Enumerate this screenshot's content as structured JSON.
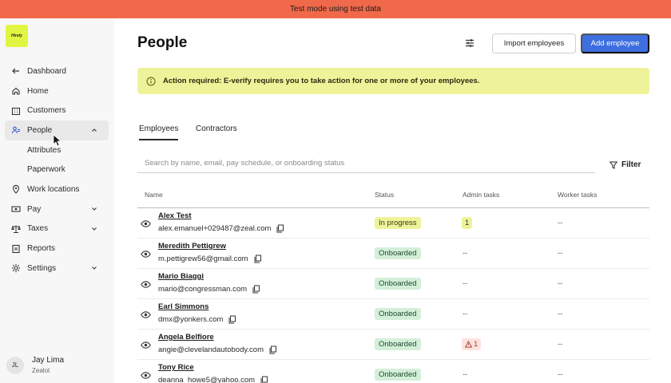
{
  "banner": {
    "text": "Test mode using test data"
  },
  "logo": {
    "text": "Hirely"
  },
  "sidebar": {
    "items": [
      {
        "label": "Dashboard",
        "icon": "arrow-left-icon"
      },
      {
        "label": "Home",
        "icon": "home-icon"
      },
      {
        "label": "Customers",
        "icon": "building-icon"
      },
      {
        "label": "People",
        "icon": "people-icon",
        "active": true,
        "expanded": true
      },
      {
        "label": "Attributes",
        "sub": true
      },
      {
        "label": "Paperwork",
        "sub": true
      },
      {
        "label": "Work locations",
        "icon": "location-pin-icon"
      },
      {
        "label": "Pay",
        "icon": "cash-icon",
        "chevron": true
      },
      {
        "label": "Taxes",
        "icon": "scales-icon",
        "chevron": true
      },
      {
        "label": "Reports",
        "icon": "report-icon"
      },
      {
        "label": "Settings",
        "icon": "gear-icon",
        "chevron": true
      }
    ]
  },
  "user": {
    "initials": "JL",
    "name": "Jay Lima",
    "role": "Zealot"
  },
  "header": {
    "title": "People",
    "import_label": "Import employees",
    "add_label": "Add employee"
  },
  "alert": {
    "text": "Action required: E-verify requires you to take action for one or more of your employees."
  },
  "tabs": [
    {
      "label": "Employees"
    },
    {
      "label": "Contractors"
    }
  ],
  "search": {
    "placeholder": "Search by name, email, pay schedule, or onboarding status"
  },
  "filter_label": "Filter",
  "table": {
    "headers": {
      "name": "Name",
      "status": "Status",
      "admin": "Admin tasks",
      "worker": "Worker tasks"
    },
    "rows": [
      {
        "name": "Alex Test",
        "email": "alex.emanuel+029487@zeal.com",
        "status": "In progress",
        "admin": "1",
        "worker": "--"
      },
      {
        "name": "Meredith Pettigrew",
        "email": "m.pettigrew56@gmail.com",
        "status": "Onboarded",
        "admin": "--",
        "worker": "--"
      },
      {
        "name": "Mario Biaggi",
        "email": "mario@congressman.com",
        "status": "Onboarded",
        "admin": "--",
        "worker": "--"
      },
      {
        "name": "Earl Simmons",
        "email": "dmx@yonkers.com",
        "status": "Onboarded",
        "admin": "--",
        "worker": "--"
      },
      {
        "name": "Angela Belfiore",
        "email": "angie@clevelandautobody.com",
        "status": "Onboarded",
        "admin": "1",
        "worker": "--"
      },
      {
        "name": "Tony Rice",
        "email": "deanna_howe5@yahoo.com",
        "status": "Onboarded",
        "admin": "--",
        "worker": "--"
      }
    ]
  },
  "colors": {
    "banner": "#f0694a",
    "accent": "#3e6fe0",
    "alert_bg": "#eef39a",
    "onboarded_bg": "#d3efd9",
    "warning_bg": "#fbe3df"
  }
}
